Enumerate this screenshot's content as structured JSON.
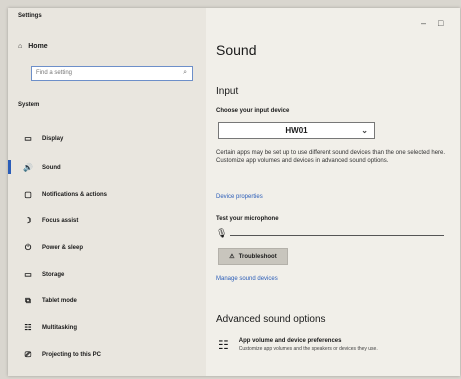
{
  "window": {
    "title": "Settings",
    "minimize": "–",
    "maximize": "□"
  },
  "sidebar": {
    "home": {
      "icon": "home-icon",
      "label": "Home"
    },
    "search": {
      "placeholder": "Find a setting",
      "icon": "search-icon"
    },
    "section": "System",
    "items": [
      {
        "icon": "display-icon",
        "glyph": "▭",
        "label": "Display"
      },
      {
        "icon": "speaker-icon",
        "glyph": "🔊",
        "label": "Sound"
      },
      {
        "icon": "notifications-icon",
        "glyph": "▢",
        "label": "Notifications & actions"
      },
      {
        "icon": "focus-assist-icon",
        "glyph": "☽",
        "label": "Focus assist"
      },
      {
        "icon": "power-icon",
        "glyph": "⏻",
        "label": "Power & sleep"
      },
      {
        "icon": "storage-icon",
        "glyph": "▭",
        "label": "Storage"
      },
      {
        "icon": "tablet-mode-icon",
        "glyph": "⧉",
        "label": "Tablet mode"
      },
      {
        "icon": "multitasking-icon",
        "glyph": "☷",
        "label": "Multitasking"
      },
      {
        "icon": "projecting-icon",
        "glyph": "⎚",
        "label": "Projecting to this PC"
      }
    ],
    "active": "Sound"
  },
  "main": {
    "title": "Sound",
    "input": {
      "heading": "Input",
      "device_label": "Choose your input device",
      "device_value": "HW01",
      "description": "Certain apps may be set up to use different sound devices than the one selected here. Customize app volumes and devices in advanced sound options.",
      "device_properties_link": "Device properties",
      "mic_test_label": "Test your microphone",
      "mic_level": 0,
      "troubleshoot_label": "Troubleshoot",
      "manage_link": "Manage sound devices"
    },
    "advanced": {
      "heading": "Advanced sound options",
      "app_title": "App volume and device preferences",
      "app_desc": "Customize app volumes and the speakers or devices they use."
    }
  },
  "colors": {
    "accent": "#2b5db8",
    "sidebar_bg": "#e9e6df",
    "content_bg": "#f1efe9"
  }
}
